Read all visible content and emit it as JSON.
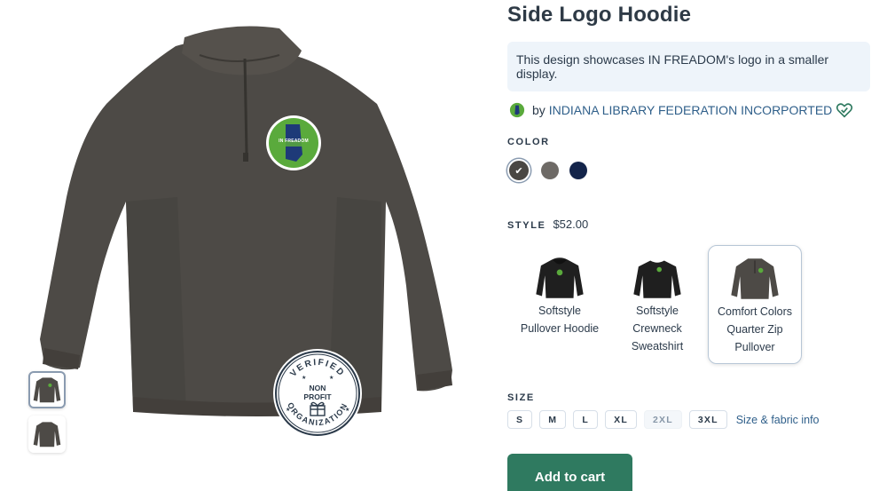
{
  "product": {
    "title": "Side Logo Hoodie",
    "description": "This design showcases IN FREADOM's logo in a smaller display.",
    "by_label": "by",
    "organization": "INDIANA LIBRARY FEDERATION INCORPORTED",
    "logo_text": "IN FREADOM"
  },
  "badge": {
    "top": "VERIFIED",
    "middle_1": "NON",
    "middle_2": "PROFIT",
    "bottom": "ORGANIZATION"
  },
  "color": {
    "label": "COLOR",
    "swatches": [
      {
        "name": "pepper",
        "hex": "#4a4743",
        "selected": true
      },
      {
        "name": "grey",
        "hex": "#6e6a66",
        "selected": false
      },
      {
        "name": "navy",
        "hex": "#13244a",
        "selected": false
      }
    ]
  },
  "style": {
    "label": "STYLE",
    "price": "$52.00",
    "options": [
      {
        "name": "Softstyle Pullover Hoodie",
        "selected": false
      },
      {
        "name": "Softstyle Crewneck Sweatshirt",
        "selected": false
      },
      {
        "name": "Comfort Colors Quarter Zip Pullover",
        "selected": true
      }
    ]
  },
  "size": {
    "label": "SIZE",
    "options": [
      {
        "label": "S",
        "available": true
      },
      {
        "label": "M",
        "available": true
      },
      {
        "label": "L",
        "available": true
      },
      {
        "label": "XL",
        "available": true
      },
      {
        "label": "2XL",
        "available": false
      },
      {
        "label": "3XL",
        "available": true
      }
    ],
    "info_link": "Size & fabric info"
  },
  "cart": {
    "button_label": "Add to cart"
  },
  "colors": {
    "accent_green": "#2f7a60",
    "link_blue": "#2f5f8a",
    "garment": "#4d4a46",
    "logo_green": "#5aaa3c",
    "logo_navy": "#1e3a78"
  }
}
